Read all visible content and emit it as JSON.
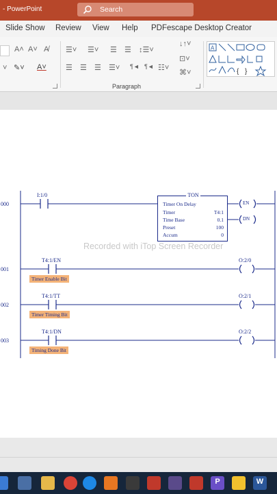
{
  "window": {
    "app_title": "- PowerPoint"
  },
  "search": {
    "placeholder": "Search"
  },
  "menu": {
    "slide_show": "Slide Show",
    "review": "Review",
    "view": "View",
    "help": "Help",
    "pdfescape": "PDFescape Desktop Creator"
  },
  "ribbon": {
    "paragraph_group": "Paragraph"
  },
  "ladder": {
    "rungs": [
      {
        "number": "000",
        "input": "I:1/0"
      },
      {
        "number": "001",
        "input": "T4:1/EN",
        "description": "Timer Enable Bit",
        "output": "O:2/0"
      },
      {
        "number": "002",
        "input": "T4:1/TT",
        "description": "Timer Timing Bit",
        "output": "O:2/1"
      },
      {
        "number": "003",
        "input": "T4:1/DN",
        "description": "Timing Done Bit",
        "output": "O:2/2"
      }
    ],
    "ton": {
      "title": "TON",
      "subtitle": "Timer On Delay",
      "timer_label": "Timer",
      "timer_value": "T4:1",
      "timebase_label": "Time Base",
      "timebase_value": "0.1",
      "preset_label": "Preset",
      "preset_value": "100",
      "accum_label": "Accum",
      "accum_value": "0",
      "en": "EN",
      "dn": "DN"
    }
  },
  "watermark": "Recorded with iTop Screen Recorder",
  "taskbar": {
    "powerpoint_label": "P",
    "word_label": "W"
  },
  "colors": {
    "accent": "#b7472a",
    "ladder_blue": "#1a2a8a",
    "description_bg": "#f4b378"
  }
}
